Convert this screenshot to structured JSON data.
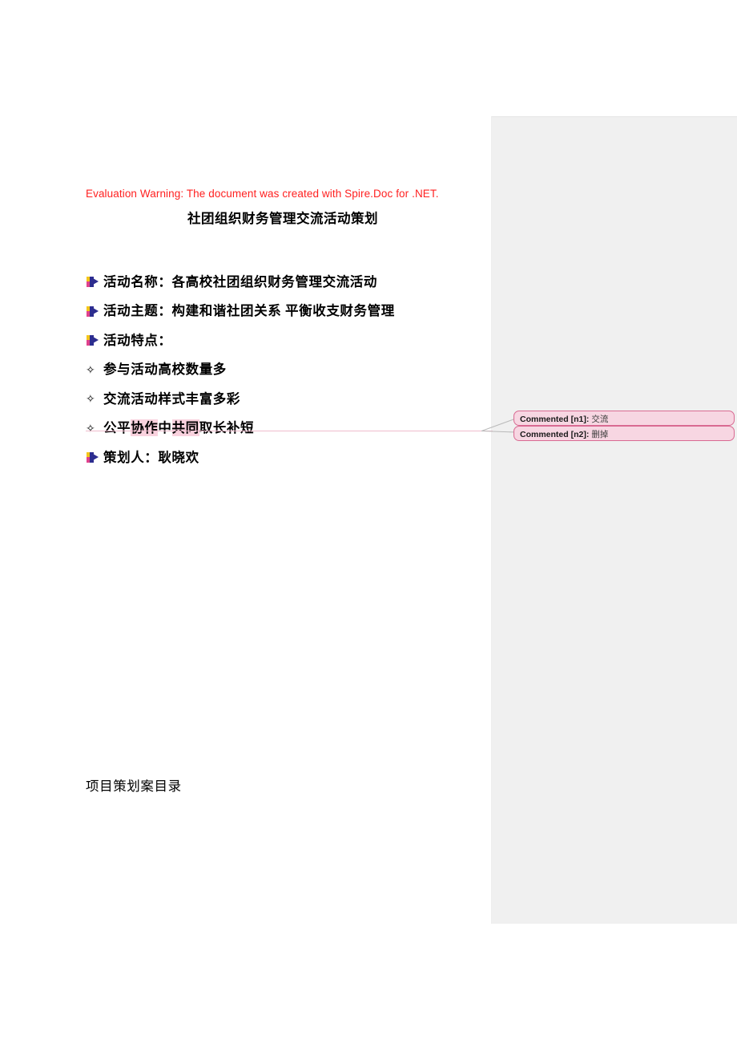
{
  "document": {
    "evaluation_warning": "Evaluation Warning: The document was created with Spire.Doc for .NET.",
    "title": "社团组织财务管理交流活动策划",
    "bottom_text": "项目策划案目录"
  },
  "body_lines": [
    {
      "bullet": "arrow-bullet-icon",
      "text": "活动名称：各高校社团组织财务管理交流活动"
    },
    {
      "bullet": "arrow-bullet-icon",
      "text": "活动主题：构建和谐社团关系  平衡收支财务管理"
    },
    {
      "bullet": "arrow-bullet-icon",
      "text": "活动特点："
    },
    {
      "bullet": "diamond-bullet-icon",
      "text": "参与活动高校数量多"
    },
    {
      "bullet": "diamond-bullet-icon",
      "text": "交流活动样式丰富多彩"
    },
    {
      "bullet": "diamond-bullet-icon",
      "text": "公平协作中共同取长补短"
    },
    {
      "bullet": "arrow-bullet-icon",
      "text": "策划人：耿晓欢"
    }
  ],
  "highlighted_line": {
    "prefix": "公平",
    "highlight_1": "协作",
    "middle": "中",
    "highlight_2": "共同",
    "suffix": "取长补短"
  },
  "diamond_glyph": "✧",
  "comments": [
    {
      "label": "Commented [n1]:",
      "text": "交流"
    },
    {
      "label": "Commented [n2]:",
      "text": "删掉"
    }
  ],
  "colors": {
    "warning_red": "#ff2020",
    "highlight_pink": "#f9d2de",
    "comment_fill": "#f7d6e2",
    "comment_border": "#d96a92",
    "margin_gray": "#f0f0f0",
    "anchor_line": "#f0bccd"
  }
}
